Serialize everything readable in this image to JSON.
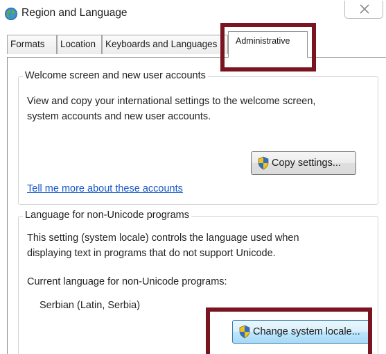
{
  "window": {
    "title": "Region and Language"
  },
  "tabs": [
    {
      "label": "Formats"
    },
    {
      "label": "Location"
    },
    {
      "label": "Keyboards and Languages"
    },
    {
      "label": "Administrative"
    }
  ],
  "welcome_group": {
    "legend": "Welcome screen and new user accounts",
    "description_line1": "View and copy your international settings to the welcome screen,",
    "description_line2": "system accounts and new user accounts.",
    "copy_button": "Copy settings...",
    "link": "Tell me more about these accounts"
  },
  "nonunicode_group": {
    "legend": "Language for non-Unicode programs",
    "description_line1": "This setting (system locale) controls the language used when",
    "description_line2": "displaying text in programs that do not support Unicode.",
    "current_label": "Current language for non-Unicode programs:",
    "current_value": "Serbian (Latin, Serbia)",
    "change_button": "Change system locale..."
  },
  "colors": {
    "highlight": "#7a1420",
    "link": "#1558c7",
    "shield_blue": "#2f6fc4",
    "shield_yellow": "#f0c419"
  },
  "icons": [
    "globe-icon",
    "close-icon",
    "uac-shield-icon"
  ]
}
